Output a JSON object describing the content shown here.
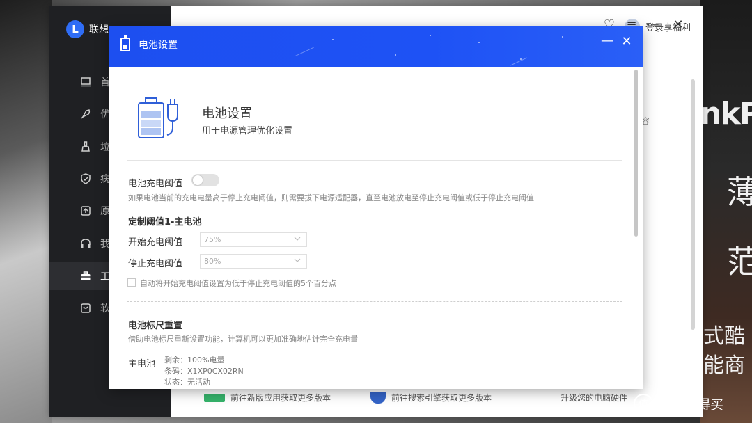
{
  "background": {
    "brand_fragment": "nkPa",
    "char1": "薄",
    "char2": "范",
    "line1": "式酷",
    "line2": "能商",
    "watermark_logo": "值",
    "watermark_text": "什么值得买"
  },
  "app": {
    "logo_letter": "L",
    "logo_text": "联想",
    "sidebar": [
      {
        "label": "首",
        "icon": "laptop-icon"
      },
      {
        "label": "优",
        "icon": "rocket-icon"
      },
      {
        "label": "垃",
        "icon": "broom-icon"
      },
      {
        "label": "病",
        "icon": "shield-icon"
      },
      {
        "label": "原",
        "icon": "upload-icon"
      },
      {
        "label": "我",
        "icon": "headset-icon"
      },
      {
        "label": "工",
        "icon": "toolbox-icon",
        "active": true
      },
      {
        "label": "软",
        "icon": "store-icon"
      }
    ],
    "user_label": "登录享福利",
    "partial_text": "容",
    "bottom_row": [
      {
        "text": "前往新版应用获取更多版本"
      },
      {
        "text": "前往搜索引擎获取更多版本"
      },
      {
        "text": "升级您的电脑硬件"
      }
    ]
  },
  "dialog": {
    "title": "电池设置",
    "min_glyph": "—",
    "close_glyph": "✕",
    "hero": {
      "title": "电池设置",
      "subtitle": "用于电源管理优化设置"
    },
    "threshold": {
      "label": "电池充电阈值",
      "enabled": false,
      "description": "如果电池当前的充电电量高于停止充电阈值，则需要拔下电源适配器，直至电池放电至停止充电阈值或低于停止充电阈值"
    },
    "custom": {
      "heading": "定制阈值1-主电池",
      "start_label": "开始充电阈值",
      "start_value": "75%",
      "stop_label": "停止充电阈值",
      "stop_value": "80%",
      "auto_checkbox_label": "自动将开始充电阈值设置为低于停止充电阈值的5个百分点",
      "auto_checked": false
    },
    "gauge": {
      "heading": "电池标尺重置",
      "description": "借助电池标尺重新设置功能，计算机可以更加准确地估计完全充电量",
      "battery_label": "主电池",
      "remaining": "剩余：100%电量",
      "barcode": "条码：X1XP0CX02RN",
      "status": "状态：无活动"
    }
  }
}
